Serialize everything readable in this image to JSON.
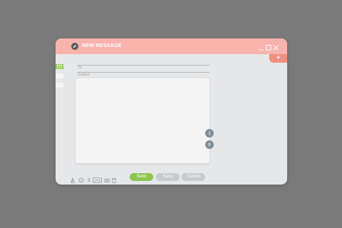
{
  "window": {
    "title": "NEW MESSAGE",
    "title_icon": "pencil-icon",
    "controls": [
      "minimize-icon",
      "maximize-icon",
      "close-icon"
    ],
    "add_tab_label": "+"
  },
  "sidebar": {
    "items": [
      {
        "icon": "mail-icon",
        "active": true
      },
      {
        "icon": "folder-icon",
        "active": false
      },
      {
        "icon": "folder-icon",
        "active": false
      }
    ]
  },
  "form": {
    "to_placeholder": "To:",
    "subject_placeholder": "Subject",
    "body_value": ""
  },
  "side_actions": [
    "more-vertical-icon",
    "attachment-icon"
  ],
  "toolbar": {
    "tools": [
      "text-format-icon",
      "emoji-icon",
      "attach-icon",
      "image-icon",
      "camera-icon",
      "trash-icon"
    ],
    "send_label": "Send",
    "save_label": "Save",
    "cancel_label": "Cancel"
  },
  "colors": {
    "titlebar": "#f7b3ac",
    "accent": "#f08f7f",
    "send": "#8ec44f",
    "secondary": "#c9cacc",
    "background": "#7a7a7a"
  }
}
